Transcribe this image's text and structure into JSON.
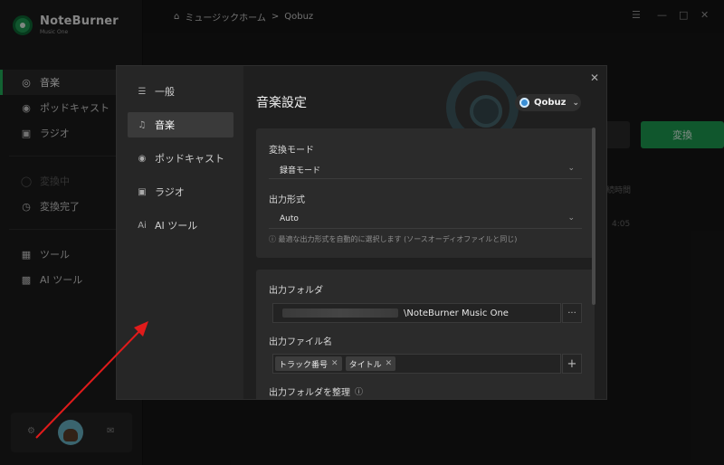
{
  "app": {
    "name": "NoteBurner",
    "subtitle": "Music One"
  },
  "sidebar": {
    "items": [
      {
        "label": "音楽",
        "icon": "headphones-icon"
      },
      {
        "label": "ポッドキャスト",
        "icon": "podcast-icon"
      },
      {
        "label": "ラジオ",
        "icon": "radio-icon"
      },
      {
        "label": "変換中",
        "icon": "converting-icon"
      },
      {
        "label": "変換完了",
        "icon": "clock-icon"
      },
      {
        "label": "ツール",
        "icon": "toolbox-icon"
      },
      {
        "label": "AI ツール",
        "icon": "ai-icon"
      }
    ]
  },
  "topbar": {
    "home": "ミュージックホーム",
    "sep": ">",
    "current": "Qobuz"
  },
  "background": {
    "convert_button": "変換",
    "col_header": "続時間",
    "time": "4:05"
  },
  "dialog": {
    "nav": [
      {
        "label": "一般",
        "icon": "sliders-icon"
      },
      {
        "label": "音楽",
        "icon": "music-note-icon"
      },
      {
        "label": "ポッドキャスト",
        "icon": "podcast-icon"
      },
      {
        "label": "ラジオ",
        "icon": "radio-icon"
      },
      {
        "label": "AI ツール",
        "icon": "ai-icon"
      }
    ],
    "title": "音楽設定",
    "source": "Qobuz",
    "convert_mode_label": "変換モード",
    "convert_mode_value": "録音モード",
    "output_format_label": "出力形式",
    "output_format_value": "Auto",
    "output_format_hint": "最適な出力形式を自動的に選択します (ソースオーディオファイルと同じ)",
    "output_folder_label": "出力フォルダ",
    "output_folder_value": "\\NoteBurner Music One",
    "browse_button": "···",
    "output_filename_label": "出力ファイル名",
    "filename_tags": [
      "トラック番号",
      "タイトル"
    ],
    "add_button": "+",
    "organize_label": "出力フォルダを整理"
  },
  "colors": {
    "accent": "#21b35b",
    "arrow": "#e01b1b"
  }
}
